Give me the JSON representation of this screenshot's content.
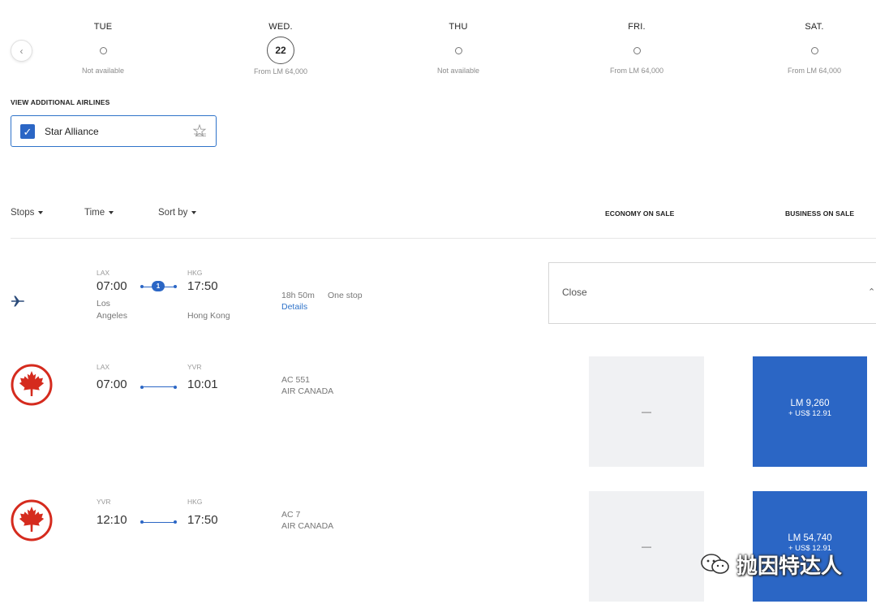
{
  "date_strip": {
    "days": [
      {
        "name": "TUE",
        "note": "Not available",
        "date": ""
      },
      {
        "name": "WED.",
        "note": "From LM 64,000",
        "date": "22"
      },
      {
        "name": "THU",
        "note": "Not available",
        "date": ""
      },
      {
        "name": "FRI.",
        "note": "From LM 64,000",
        "date": ""
      },
      {
        "name": "SAT.",
        "note": "From LM 64,000",
        "date": ""
      }
    ],
    "selected_index": 1,
    "prev_icon": "chevron-left-icon"
  },
  "additional_airlines": {
    "label": "VIEW ADDITIONAL AIRLINES",
    "option": {
      "label": "Star Alliance",
      "checked": true,
      "icon": "star-alliance-logo"
    }
  },
  "sort_bar": {
    "stops": "Stops",
    "time": "Time",
    "sort_by": "Sort by",
    "economy_header": "ECONOMY ON SALE",
    "business_header": "BUSINESS ON SALE"
  },
  "itinerary": {
    "origin_code": "LAX",
    "origin_time": "07:00",
    "origin_city_line1": "Los",
    "origin_city_line2": "Angeles",
    "dest_code": "HKG",
    "dest_time": "17:50",
    "dest_city": "Hong Kong",
    "stops_count": "1",
    "duration": "18h 50m",
    "stops_text": "One stop",
    "details_link": "Details",
    "close_label": "Close",
    "icon": "airplane-icon"
  },
  "segments": [
    {
      "origin_code": "LAX",
      "origin_time": "07:00",
      "dest_code": "YVR",
      "dest_time": "10:01",
      "flight_number": "AC 551",
      "airline": "AIR CANADA",
      "economy": "—",
      "business_price": "LM 9,260",
      "business_tax": "+ US$ 12.91"
    },
    {
      "origin_code": "YVR",
      "origin_time": "12:10",
      "dest_code": "HKG",
      "dest_time": "17:50",
      "flight_number": "AC 7",
      "airline": "AIR CANADA",
      "economy": "—",
      "business_price": "LM 54,740",
      "business_tax": "+ US$ 12.91"
    }
  ],
  "watermark": {
    "text": "抛因特达人",
    "icon": "wechat-icon"
  },
  "colors": {
    "accent": "#2b66c5",
    "air_canada_red": "#d52b1e",
    "econ_bg": "#f0f1f3"
  }
}
